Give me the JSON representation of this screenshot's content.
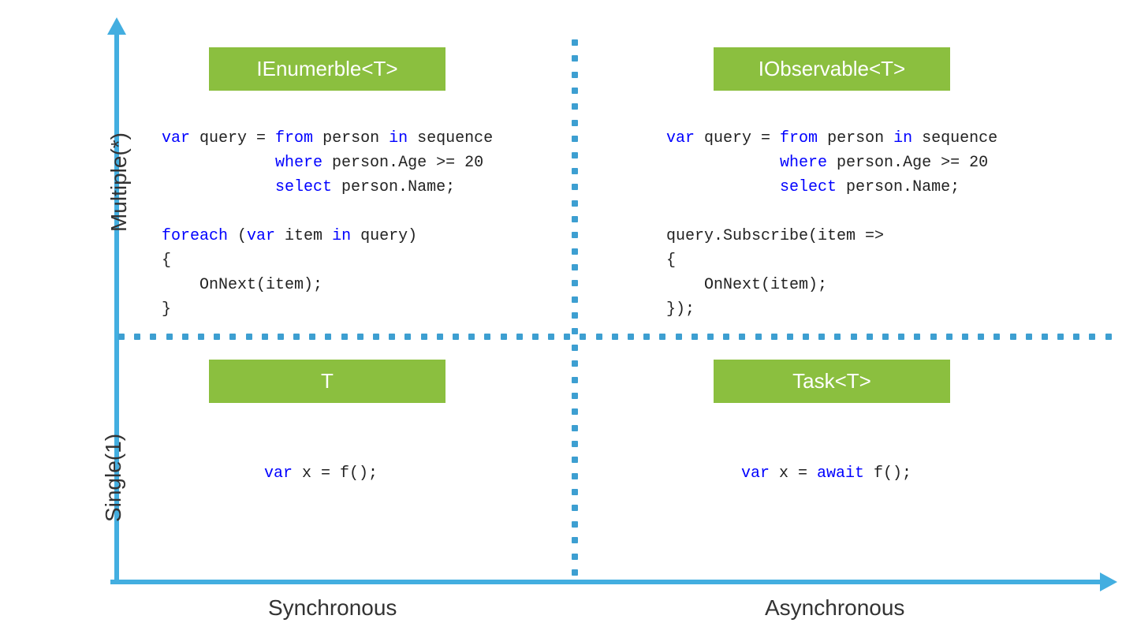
{
  "axes": {
    "y_top": "Multiple(*)",
    "y_bottom": "Single(1)",
    "x_left": "Synchronous",
    "x_right": "Asynchronous"
  },
  "quadrants": {
    "tl": {
      "tag": "IEnumerble<T>"
    },
    "tr": {
      "tag": "IObservable<T>"
    },
    "bl": {
      "tag": "T"
    },
    "br": {
      "tag": "Task<T>"
    }
  },
  "code": {
    "tl_1a": "var",
    "tl_1b": " query = ",
    "tl_1c": "from",
    "tl_1d": " person ",
    "tl_1e": "in",
    "tl_1f": " sequence",
    "tl_2a": "            ",
    "tl_2b": "where",
    "tl_2c": " person.Age >= 20",
    "tl_3a": "            ",
    "tl_3b": "select",
    "tl_3c": " person.Name;",
    "tl_blank": "",
    "tl_4a": "foreach",
    "tl_4b": " (",
    "tl_4c": "var",
    "tl_4d": " item ",
    "tl_4e": "in",
    "tl_4f": " query)",
    "tl_5": "{",
    "tl_6": "    OnNext(item);",
    "tl_7": "}",
    "tr_4": "query.Subscribe(item =>",
    "tr_5": "{",
    "tr_6": "    OnNext(item);",
    "tr_7": "});",
    "bl_a": "var",
    "bl_b": " x = f();",
    "br_a": "var",
    "br_b": " x = ",
    "br_c": "await",
    "br_d": " f();"
  },
  "colors": {
    "axis": "#43aee0",
    "dots": "#3d9fd1",
    "tag": "#8bbf3f",
    "keyword": "#0000ff"
  }
}
